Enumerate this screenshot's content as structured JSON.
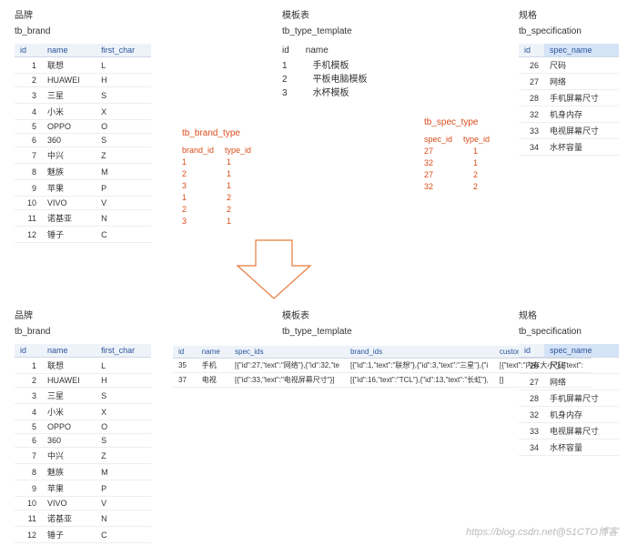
{
  "labels": {
    "brand": "品牌",
    "template": "模板表",
    "spec": "规格",
    "brand_tbl": "tb_brand",
    "tpl_tbl": "tb_type_template",
    "spec_tbl": "tb_specification",
    "brand_type": "tb_brand_type",
    "spec_type": "tb_spec_type"
  },
  "brand_cols": {
    "id": "id",
    "name": "name",
    "fc": "first_char"
  },
  "brands": [
    {
      "id": "1",
      "name": "联想",
      "fc": "L"
    },
    {
      "id": "2",
      "name": "HUAWEI",
      "fc": "H"
    },
    {
      "id": "3",
      "name": "三星",
      "fc": "S"
    },
    {
      "id": "4",
      "name": "小米",
      "fc": "X"
    },
    {
      "id": "5",
      "name": "OPPO",
      "fc": "O"
    },
    {
      "id": "6",
      "name": "360",
      "fc": "S"
    },
    {
      "id": "7",
      "name": "中兴",
      "fc": "Z"
    },
    {
      "id": "8",
      "name": "魅族",
      "fc": "M"
    },
    {
      "id": "9",
      "name": "苹果",
      "fc": "P"
    },
    {
      "id": "10",
      "name": "VIVO",
      "fc": "V"
    },
    {
      "id": "11",
      "name": "诺基亚",
      "fc": "N"
    },
    {
      "id": "12",
      "name": "锤子",
      "fc": "C"
    }
  ],
  "tpl_cols": {
    "id": "id",
    "name": "name"
  },
  "templates": [
    {
      "id": "1",
      "name": "手机模板"
    },
    {
      "id": "2",
      "name": "平板电脑模板"
    },
    {
      "id": "3",
      "name": "水杯模板"
    }
  ],
  "spec_cols": {
    "id": "id",
    "name": "spec_name"
  },
  "specs": [
    {
      "id": "26",
      "name": "尺码"
    },
    {
      "id": "27",
      "name": "网络"
    },
    {
      "id": "28",
      "name": "手机屏幕尺寸"
    },
    {
      "id": "32",
      "name": "机身内存"
    },
    {
      "id": "33",
      "name": "电视屏幕尺寸"
    },
    {
      "id": "34",
      "name": "水杯容量"
    }
  ],
  "bt_cols": {
    "b": "brand_id",
    "t": "type_id"
  },
  "brand_type": [
    {
      "b": "1",
      "t": "1"
    },
    {
      "b": "2",
      "t": "1"
    },
    {
      "b": "3",
      "t": "1"
    },
    {
      "b": "1",
      "t": "2"
    },
    {
      "b": "2",
      "t": "2"
    },
    {
      "b": "3",
      "t": "1"
    }
  ],
  "st_cols": {
    "s": "spec_id",
    "t": "type_id"
  },
  "spec_type": [
    {
      "s": "27",
      "t": "1"
    },
    {
      "s": "32",
      "t": "1"
    },
    {
      "s": "27",
      "t": "2"
    },
    {
      "s": "32",
      "t": "2"
    }
  ],
  "wide_cols": {
    "id": "id",
    "name": "name",
    "sids": "spec_ids",
    "bids": "brand_ids",
    "cai": "custom_attribute_items"
  },
  "wide_rows": [
    {
      "id": "35",
      "name": "手机",
      "sids": "[{\"id\":27,\"text\":\"网络\"},{\"id\":32,\"te",
      "bids": "[{\"id\":1,\"text\":\"联想\"},{\"id\":3,\"text\":\"三星\"},{\"i",
      "cai": "[{\"text\":\"内存大小\"},{\"text\":"
    },
    {
      "id": "37",
      "name": "电视",
      "sids": "[{\"id\":33,\"text\":\"电视屏幕尺寸\"}]",
      "bids": "[{\"id\":16,\"text\":\"TCL\"},{\"id\":13,\"text\":\"长虹\"},",
      "cai": "[]"
    }
  ],
  "watermark": "https://blog.csdn.net@51CTO博客"
}
